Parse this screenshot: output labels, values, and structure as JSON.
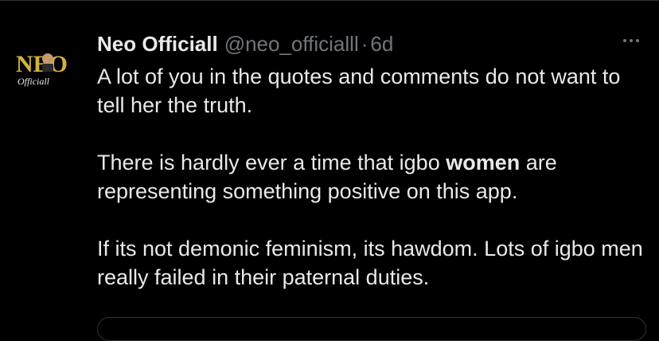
{
  "tweet": {
    "display_name": "Neo Officiall",
    "handle": "@neo_officialll",
    "separator": "·",
    "time": "6d",
    "avatar": {
      "logo_text": "NEO",
      "logo_subtext": "Officiall",
      "logo_color": "#d4b13a"
    },
    "paragraphs": [
      {
        "text": "A lot of you in the quotes and comments do not want to tell her the truth."
      },
      {
        "before": "There is hardly ever a time that igbo ",
        "bold": "women",
        "after": " are representing something positive on this app."
      },
      {
        "text": "If its not demonic feminism, its hawdom. Lots of igbo men really failed in their paternal duties."
      }
    ]
  },
  "colors": {
    "background": "#000000",
    "text_primary": "#e7e9ea",
    "text_secondary": "#71767b",
    "divider": "#2f3336"
  },
  "icons": {
    "more": "more-horizontal-icon"
  }
}
